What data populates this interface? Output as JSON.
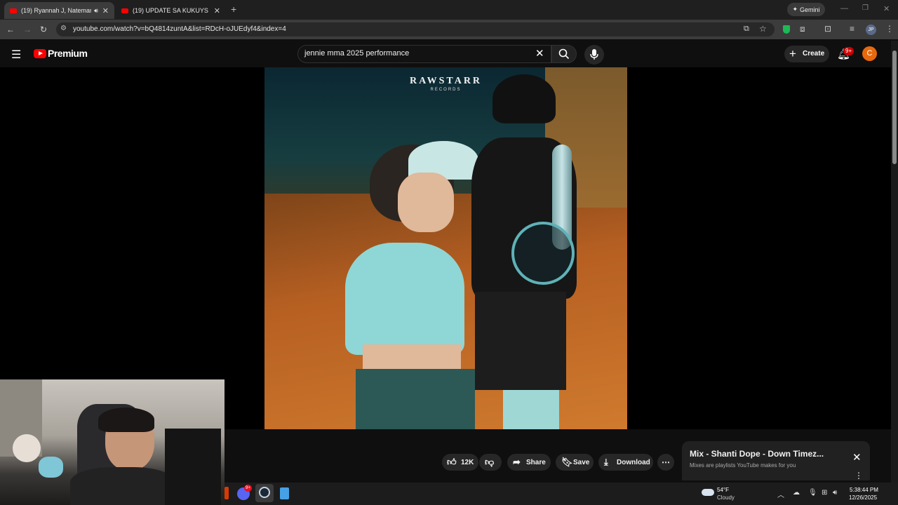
{
  "browser": {
    "tabs": [
      {
        "title": "(19) Ryannah J, Nateman - ",
        "audio_icon": "speaker-icon"
      },
      {
        "title": "(19) UPDATE SA KUKUYS NEW "
      }
    ],
    "new_tab": "+",
    "gemini_label": "Gemini",
    "url": "youtube.com/watch?v=bQ4814zuntA&list=RDcH-oJUEdyf4&index=4",
    "profile_initials": "JP"
  },
  "youtube": {
    "logo_text": "Premium",
    "search_value": "jennie mma 2025 performance",
    "create_label": "Create",
    "notifications_badge": "9+",
    "avatar_letter": "C"
  },
  "video": {
    "overlay_brand": "RAWSTARR",
    "overlay_sub": "RECORDS"
  },
  "actions": {
    "like_count": "12K",
    "share_label": "Share",
    "save_label": "Save",
    "download_label": "Download"
  },
  "mix_panel": {
    "title": "Mix - Shanti Dope - Down Timez...",
    "subtitle": "Mixes are playlists YouTube makes for you"
  },
  "taskbar": {
    "discord_badge": "9+",
    "weather_temp": "54°F",
    "weather_desc": "Cloudy",
    "time": "5:38:44 PM",
    "date": "12/26/2025"
  },
  "colors": {
    "youtube_red": "#ff0000",
    "avatar_orange": "#e8690c",
    "badge_red": "#cc0000"
  }
}
